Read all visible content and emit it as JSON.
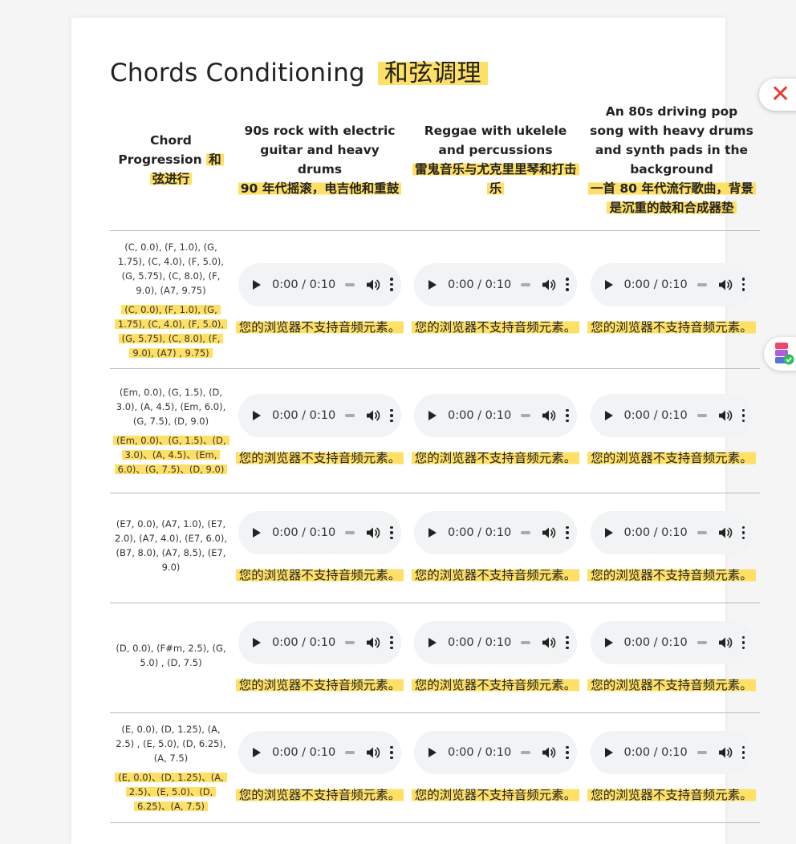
{
  "page": {
    "title_en": "Chords Conditioning",
    "title_cn": "和弦调理"
  },
  "headers": {
    "progression": {
      "en": "Chord Progression",
      "cn": "和弦进行"
    },
    "styles": [
      {
        "en": "90s rock with electric guitar and heavy drums",
        "cn": "90 年代摇滚，电吉他和重鼓"
      },
      {
        "en": "Reggae with ukelele and percussions",
        "cn": "雷鬼音乐与尤克里里琴和打击乐"
      },
      {
        "en": "An 80s driving pop song with heavy drums and synth pads in the background",
        "cn": "一首 80 年代流行歌曲，背景是沉重的鼓和合成器垫"
      }
    ]
  },
  "audio": {
    "time": "0:00 / 0:10",
    "fallback": "您的浏览器不支持音频元素。"
  },
  "rows": [
    {
      "en": "(C, 0.0), (F, 1.0), (G, 1.75), (C, 4.0), (F, 5.0), (G, 5.75), (C, 8.0), (F, 9.0), (A7, 9.75)",
      "cn": "(C, 0.0), (F, 1.0), (G, 1.75), (C, 4.0), (F, 5.0), (G, 5.75), (C, 8.0), (F, 9.0), (A7) , 9.75)"
    },
    {
      "en": "(Em, 0.0), (G, 1.5), (D, 3.0), (A, 4.5), (Em, 6.0), (G, 7.5), (D, 9.0)",
      "cn": "(Em, 0.0)、(G, 1.5)、(D, 3.0)、(A, 4.5)、(Em, 6.0)、(G, 7.5)、(D, 9.0)"
    },
    {
      "en": "(E7, 0.0), (A7, 1.0), (E7, 2.0), (A7, 4.0), (E7, 6.0), (B7, 8.0), (A7, 8.5), (E7, 9.0)",
      "cn": ""
    },
    {
      "en": "(D, 0.0), (F#m, 2.5), (G, 5.0) , (D, 7.5)",
      "cn": ""
    },
    {
      "en": "(E, 0.0), (D, 1.25), (A, 2.5) , (E, 5.0), (D, 6.25), (A, 7.5)",
      "cn": "(E, 0.0)、(D, 1.25)、(A, 2.5)、(E, 5.0)、(D, 6.25)、(A, 7.5)"
    }
  ],
  "colors": {
    "highlight": "#ffe066",
    "audio_bg": "#f1f3f4",
    "close_icon": "#e53935"
  },
  "icons": [
    "play-icon",
    "volume-icon",
    "more-options-icon",
    "close-icon",
    "app-icon"
  ]
}
